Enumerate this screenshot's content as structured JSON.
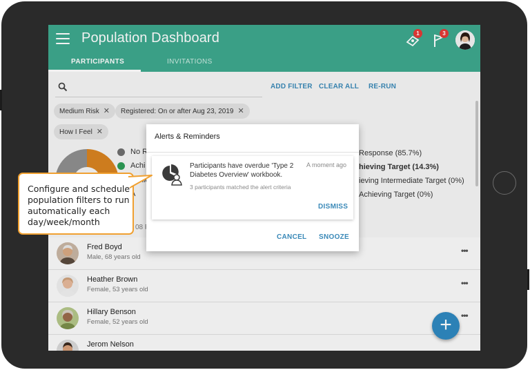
{
  "app": {
    "title": "Population Dashboard",
    "notifications_badge": "1",
    "flags_badge": "3",
    "accent_color": "#3ea88e"
  },
  "tabs": [
    {
      "label": "PARTICIPANTS",
      "active": true
    },
    {
      "label": "INVITATIONS",
      "active": false
    }
  ],
  "search": {
    "placeholder": "",
    "icon": "search-icon"
  },
  "actions": {
    "add_filter": "ADD FILTER",
    "clear_all": "CLEAR ALL",
    "re_run": "RE-RUN"
  },
  "filters": [
    {
      "label": "Medium Risk"
    },
    {
      "label": "Registered: On or after Aug 23, 2019"
    },
    {
      "label": "How I Feel"
    }
  ],
  "legend_left": [
    {
      "label": "No R",
      "color": "#6f6f6f"
    },
    {
      "label": "Achi",
      "color": "#2e9b56"
    },
    {
      "label": "Achie",
      "color": ""
    },
    {
      "label": "A",
      "color": ""
    }
  ],
  "legend_right": [
    {
      "label": "Response (85.7%)",
      "bold": false
    },
    {
      "label": "hieving Target (14.3%)",
      "bold": true
    },
    {
      "label": "ieving Intermediate Target (0%)",
      "bold": false
    },
    {
      "label": "Achieving Target (0%)",
      "bold": false
    }
  ],
  "list_count_fragment": "08 P",
  "participants": [
    {
      "name": "Fred Boyd",
      "details": "Male, 68 years old"
    },
    {
      "name": "Heather Brown",
      "details": "Female, 53 years old"
    },
    {
      "name": "Hillary Benson",
      "details": "Female, 52 years old"
    },
    {
      "name": "Jerom Nelson",
      "details": ""
    }
  ],
  "dialog": {
    "title": "Alerts & Reminders",
    "alert": {
      "message": "Participants have overdue 'Type 2 Diabetes Overview' workbook.",
      "time": "A moment ago",
      "detail": "3 participants matched the alert criteria",
      "dismiss": "DISMISS"
    },
    "cancel": "CANCEL",
    "snooze": "SNOOZE"
  },
  "callout": {
    "text": "Configure and schedule population filters to run automatically each day/week/month"
  },
  "more_label": "•••",
  "fab_label": "+"
}
